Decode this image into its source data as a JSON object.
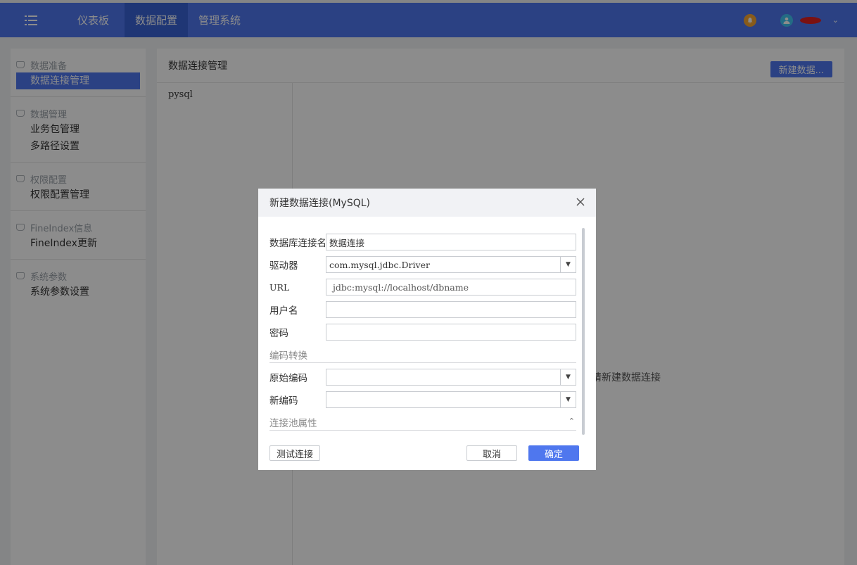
{
  "topbar": {
    "nav": [
      "仪表板",
      "数据配置",
      "管理系统"
    ],
    "active_index": 1
  },
  "sidebar": {
    "groups": [
      {
        "title": "数据准备",
        "items": [
          "数据连接管理"
        ]
      },
      {
        "title": "数据管理",
        "items": [
          "业务包管理",
          "多路径设置"
        ]
      },
      {
        "title": "权限配置",
        "items": [
          "权限配置管理"
        ]
      },
      {
        "title": "FineIndex信息",
        "items": [
          "FineIndex更新"
        ]
      },
      {
        "title": "系统参数",
        "items": [
          "系统参数设置"
        ]
      }
    ]
  },
  "main": {
    "title": "数据连接管理",
    "new_button": "新建数据...",
    "connections": [
      "pysql"
    ],
    "empty_hint": "请新建数据连接"
  },
  "dialog": {
    "title": "新建数据连接(MySQL)",
    "fields": {
      "conn_name": {
        "label": "数据库连接名",
        "value": "数据连接"
      },
      "driver": {
        "label": "驱动器",
        "value": "com.mysql.jdbc.Driver"
      },
      "url": {
        "label": "URL",
        "value": "jdbc:mysql://localhost/dbname"
      },
      "username": {
        "label": "用户名",
        "value": ""
      },
      "password": {
        "label": "密码",
        "value": ""
      }
    },
    "encoding_section": "编码转换",
    "encoding": {
      "original": {
        "label": "原始编码",
        "value": ""
      },
      "new": {
        "label": "新编码",
        "value": ""
      }
    },
    "pool_section": "连接池属性",
    "buttons": {
      "test": "测试连接",
      "cancel": "取消",
      "ok": "确定"
    }
  },
  "colors": {
    "primary": "#4f77ee",
    "active_nav": "#3a63d6",
    "bell": "#f8a630",
    "avatar": "#40c4f0"
  }
}
